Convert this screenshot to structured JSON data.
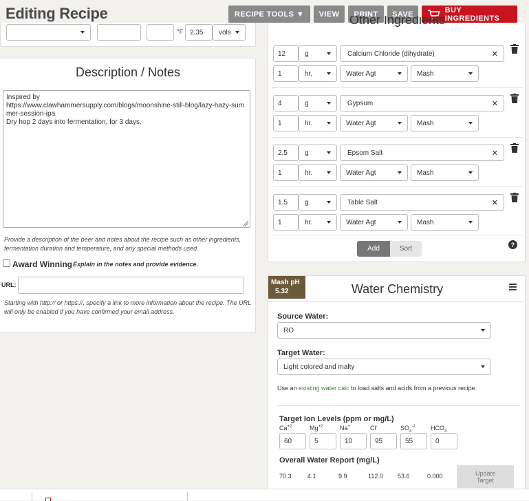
{
  "header": {
    "title": "Editing Recipe",
    "recipe_tools": "RECIPE TOOLS ▼",
    "view": "VIEW",
    "print": "PRINT",
    "save": "SAVE",
    "buy": "BUY INGREDIENTS"
  },
  "top_fields": {
    "temp_unit": "°F",
    "carbonation": "2.35",
    "carbonation_unit": "vols"
  },
  "description": {
    "heading": "Description / Notes",
    "text": "Inspired by\nhttps://www.clawhammersupply.com/blogs/moonshine-still-blog/lazy-hazy-summer-session-ipa\nDry hop 2 days into fermentation, for 3 days.",
    "help": "Provide a description of the beer and notes about the recipe such as other ingredients, fermentation duration and temperature, and any special methods used.",
    "award_label": "Award Winning",
    "award_help": "Explain in the notes and provide evidence.",
    "url_label": "URL:",
    "url_help": "Starting with http:// or https://, specify a link to more information about the recipe. The URL will only be enabled if you have confirmed your email address."
  },
  "other_ingredients": {
    "heading": "Other Ingredients",
    "items": [
      {
        "amount": "12",
        "unit": "g",
        "name": "Calcium Chloride (dihydrate)",
        "time": "1",
        "time_unit": "hr.",
        "use": "Water Agt",
        "stage": "Mash"
      },
      {
        "amount": "4",
        "unit": "g",
        "name": "Gypsum",
        "time": "1",
        "time_unit": "hr.",
        "use": "Water Agt",
        "stage": "Mash"
      },
      {
        "amount": "2.5",
        "unit": "g",
        "name": "Epsom Salt",
        "time": "1",
        "time_unit": "hr.",
        "use": "Water Agt",
        "stage": "Mash"
      },
      {
        "amount": "1.5",
        "unit": "g",
        "name": "Table Salt",
        "time": "1",
        "time_unit": "hr.",
        "use": "Water Agt",
        "stage": "Mash"
      }
    ],
    "add": "Add",
    "sort": "Sort",
    "help_icon": "?"
  },
  "water": {
    "mash_ph_label": "Mash pH",
    "mash_ph": "5.32",
    "heading": "Water Chemistry",
    "source_label": "Source Water:",
    "source_value": "RO",
    "target_label": "Target Water:",
    "target_value": "Light colored and malty",
    "use_prefix": "Use an",
    "use_link": "existing water calc",
    "use_suffix": "to load salts and acids from a previous recipe.",
    "target_ion_heading": "Target Ion Levels (ppm or mg/L)",
    "ions": [
      {
        "label": "Ca",
        "sup": "+2",
        "sub": "",
        "value": "60"
      },
      {
        "label": "Mg",
        "sup": "+2",
        "sub": "",
        "value": "5"
      },
      {
        "label": "Na",
        "sup": "+",
        "sub": "",
        "value": "10"
      },
      {
        "label": "Cl",
        "sup": "-",
        "sub": "",
        "value": "95"
      },
      {
        "label": "SO",
        "sup": "-2",
        "sub": "4",
        "value": "55"
      },
      {
        "label": "HCO",
        "sup": "",
        "sub": "3",
        "value": "0"
      }
    ],
    "report_heading": "Overall Water Report (mg/L)",
    "report": [
      "70.3",
      "4.1",
      "9.9",
      "112.0",
      "53.6",
      "0.000"
    ],
    "update_button": "Update Target"
  },
  "colors": {
    "buy_red": "#c8141e",
    "gray_button": "#8a8a8a",
    "mash_ph_bg": "#6b5a3a",
    "link_green": "#3b8a2e"
  }
}
